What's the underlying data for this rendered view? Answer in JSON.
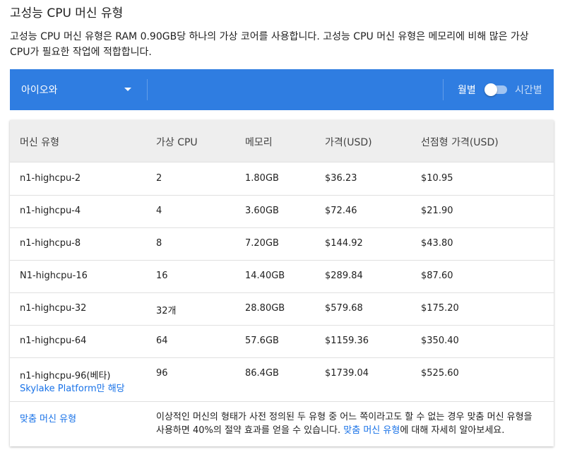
{
  "title": "고성능 CPU 머신 유형",
  "description": "고성능 CPU 머신 유형은 RAM 0.90GB당 하나의 가상 코어를 사용합니다. 고성능 CPU 머신 유형은 메모리에 비해 많은 가상 CPU가 필요한 작업에 적합합니다.",
  "toolbar": {
    "region": "아이오와",
    "monthly_label": "월별",
    "hourly_label": "시간별",
    "toggle_hourly_on": false
  },
  "table": {
    "headers": [
      "머신 유형",
      "가상 CPU",
      "메모리",
      "가격(USD)",
      "선점형 가격(USD)"
    ],
    "rows": [
      [
        "n1-highcpu-2",
        "2",
        "1.80GB",
        "$36.23",
        "$10.95"
      ],
      [
        "n1-highcpu-4",
        "4",
        "3.60GB",
        "$72.46",
        "$21.90"
      ],
      [
        "n1-highcpu-8",
        "8",
        "7.20GB",
        "$144.92",
        "$43.80"
      ],
      [
        "N1-highcpu-16",
        "16",
        "14.40GB",
        "$289.84",
        "$87.60"
      ],
      [
        "n1-highcpu-32",
        "32개",
        "28.80GB",
        "$579.68",
        "$175.20"
      ],
      [
        "n1-highcpu-64",
        "64",
        "57.6GB",
        "$1159.36",
        "$350.40"
      ],
      [
        "n1-highcpu-96(베타)",
        "96",
        "86.4GB",
        "$1739.04",
        "$525.60"
      ]
    ],
    "last_row_note": "Skylake Platform만 해당",
    "custom": {
      "label": "맞춤 머신 유형",
      "text_before": "이상적인 머신의 형태가 사전 정의된 두 유형 중 어느 쪽이라고도 할 수 없는 경우 맞춤 머신 유형을 사용하면 40%의 절약 효과를 얻을 수 있습니다. ",
      "text_link": "맞춤 머신 유형",
      "text_after": "에 대해 자세히 알아보세요."
    }
  },
  "colors": {
    "toolbar_bg": "#2f7de1",
    "link": "#1a73e8",
    "header_bg": "#eeeeee"
  }
}
